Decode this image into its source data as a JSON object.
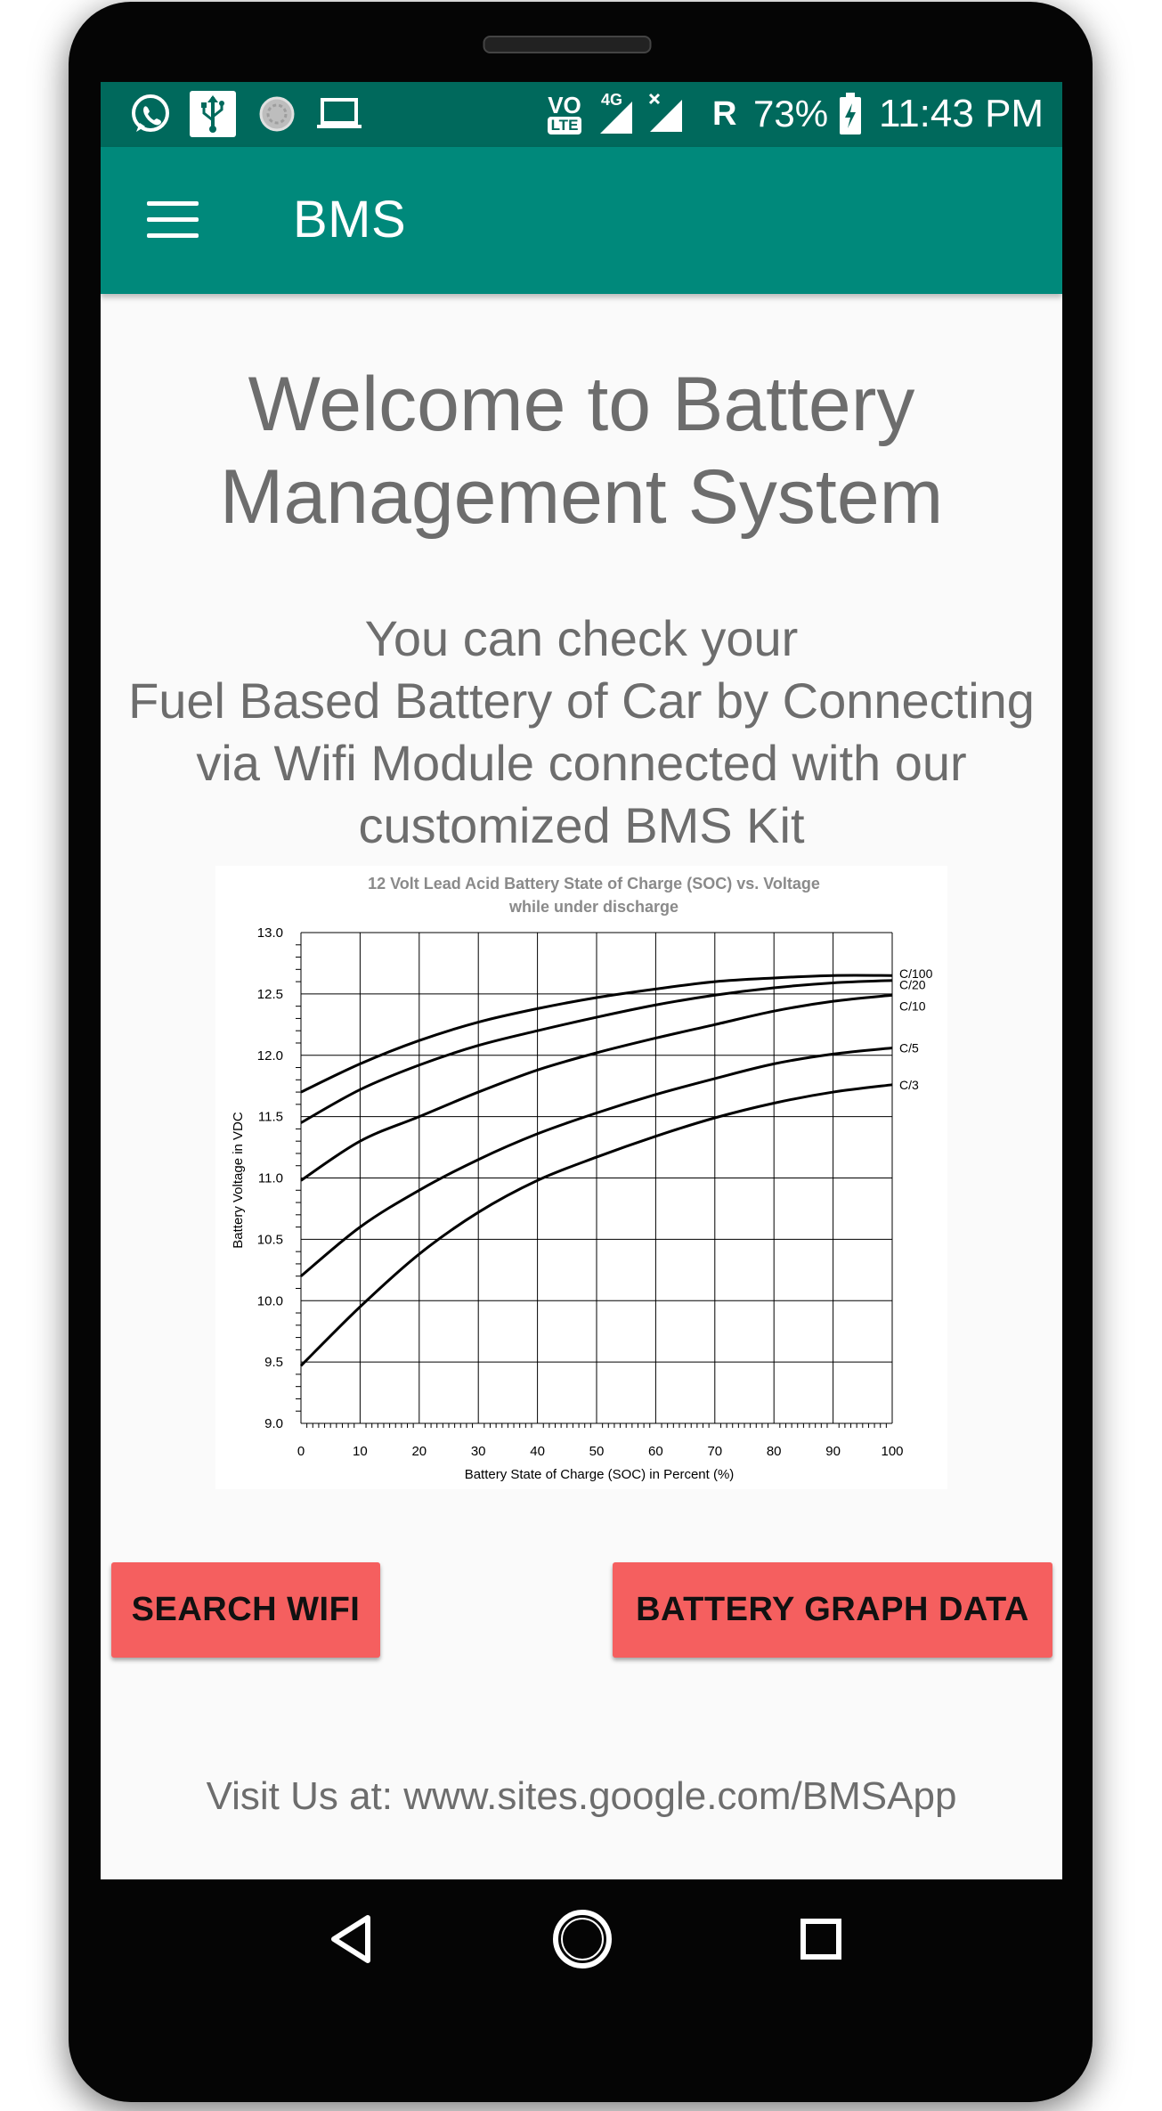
{
  "status_bar": {
    "icons": [
      "whatsapp-icon",
      "usb-icon",
      "sync-icon",
      "laptop-icon",
      "volte-icon",
      "4g-signal-icon",
      "no-signal-icon"
    ],
    "volte_label": "VO",
    "lte_label": "LTE",
    "network_label": "4G",
    "roaming": "R",
    "battery": "73%",
    "time": "11:43 PM"
  },
  "app_bar": {
    "title": "BMS"
  },
  "main": {
    "welcome_line1": "Welcome to Battery",
    "welcome_line2": "Management System",
    "desc_line1": "You can check your",
    "desc_line2": "Fuel Based Battery of Car by Connecting",
    "desc_line3": "via Wifi Module connected with our",
    "desc_line4": "customized BMS Kit",
    "search_wifi_label": "SEARCH WIFI",
    "battery_graph_label": "BATTERY GRAPH DATA",
    "visit": "Visit Us at: www.sites.google.com/BMSApp"
  },
  "colors": {
    "status_bar": "#00695c",
    "app_bar": "#00897b",
    "button": "#f55f5f",
    "text": "#6d6d6d"
  },
  "chart_data": {
    "type": "line",
    "title_line1": "12 Volt Lead Acid Battery State of Charge (SOC) vs. Voltage",
    "title_line2": "while under discharge",
    "xlabel": "Battery State of Charge (SOC) in Percent (%)",
    "ylabel": "Battery Voltage in VDC",
    "xlim": [
      0,
      100
    ],
    "ylim": [
      9.0,
      13.0
    ],
    "x_ticks": [
      0,
      10,
      20,
      30,
      40,
      50,
      60,
      70,
      80,
      90,
      100
    ],
    "y_ticks": [
      "9.0",
      "9.5",
      "10.0",
      "10.5",
      "11.0",
      "11.5",
      "12.0",
      "12.5",
      "13.0"
    ],
    "grid": true,
    "x": [
      0,
      10,
      20,
      30,
      40,
      50,
      60,
      70,
      80,
      90,
      100
    ],
    "series": [
      {
        "name": "C/100",
        "values": [
          11.7,
          11.93,
          12.12,
          12.27,
          12.38,
          12.47,
          12.54,
          12.6,
          12.63,
          12.65,
          12.65
        ]
      },
      {
        "name": "C/20",
        "values": [
          11.45,
          11.72,
          11.92,
          12.08,
          12.2,
          12.31,
          12.41,
          12.49,
          12.55,
          12.59,
          12.61
        ]
      },
      {
        "name": "C/10",
        "values": [
          10.98,
          11.3,
          11.5,
          11.7,
          11.88,
          12.02,
          12.14,
          12.25,
          12.36,
          12.44,
          12.49
        ]
      },
      {
        "name": "C/5",
        "values": [
          10.2,
          10.6,
          10.9,
          11.15,
          11.36,
          11.53,
          11.68,
          11.81,
          11.93,
          12.01,
          12.06
        ]
      },
      {
        "name": "C/3",
        "values": [
          9.47,
          9.95,
          10.38,
          10.72,
          10.98,
          11.17,
          11.34,
          11.49,
          11.61,
          11.7,
          11.76
        ]
      }
    ]
  }
}
